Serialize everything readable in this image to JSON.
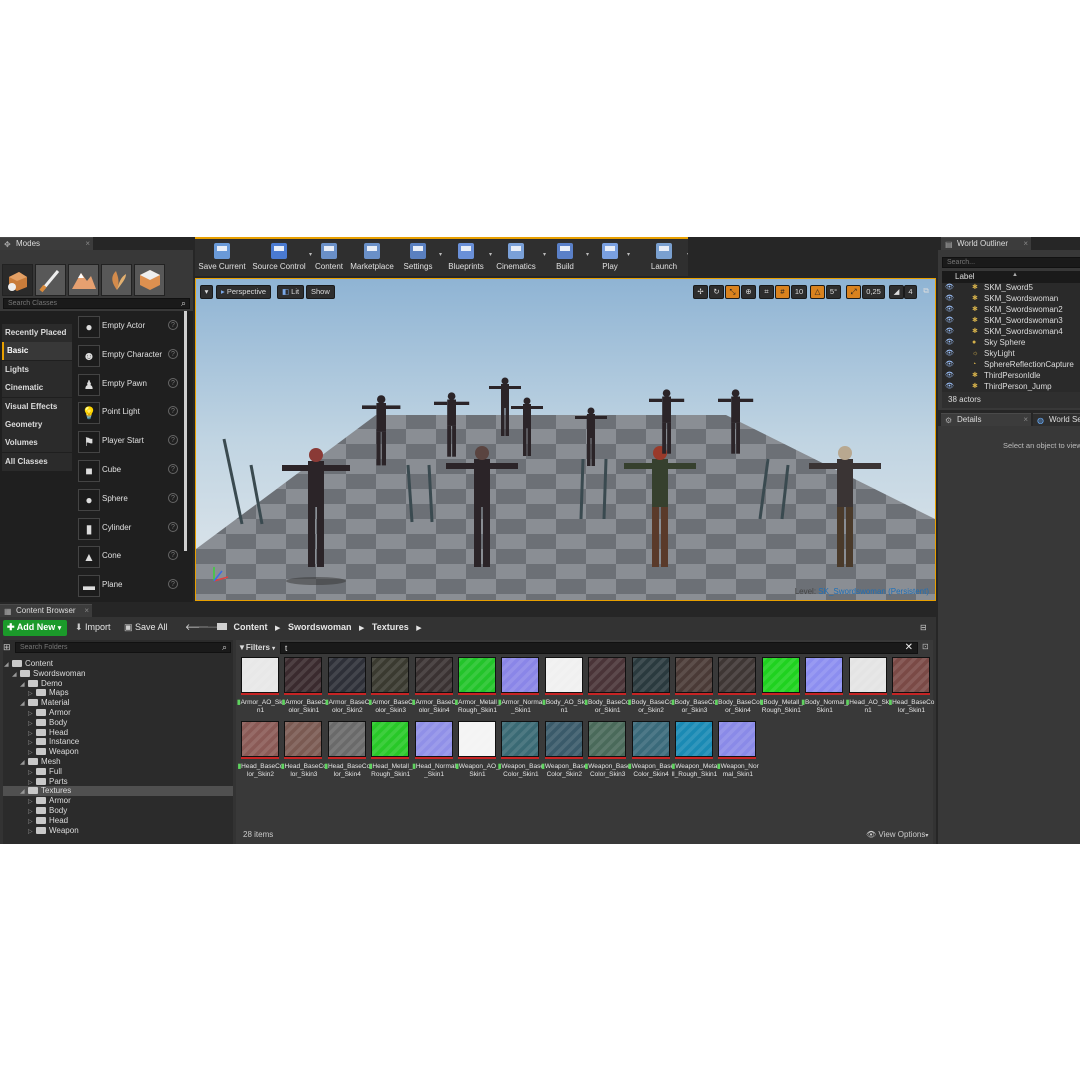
{
  "modes": {
    "tab": "Modes",
    "search_placeholder": "Search Classes",
    "categories": [
      "Recently Placed",
      "Basic",
      "Lights",
      "Cinematic",
      "Visual Effects",
      "Geometry",
      "Volumes",
      "All Classes"
    ],
    "items": [
      "Empty Actor",
      "Empty Character",
      "Empty Pawn",
      "Point Light",
      "Player Start",
      "Cube",
      "Sphere",
      "Cylinder",
      "Cone",
      "Plane"
    ]
  },
  "toolbar": {
    "buttons": [
      "Save Current",
      "Source Control",
      "Content",
      "Marketplace",
      "Settings",
      "Blueprints",
      "Cinematics",
      "Build",
      "Play",
      "Launch"
    ]
  },
  "viewport": {
    "perspective": "Perspective",
    "lit": "Lit",
    "show": "Show",
    "grid_value": "10",
    "angle_value": "5°",
    "scale_value": "0,25",
    "camera_value": "4",
    "level_label": "Level:",
    "level_name": "SK_Swordswoman (Persistent)"
  },
  "outliner": {
    "tab": "World Outliner",
    "search_placeholder": "Search...",
    "column": "Label",
    "rows": [
      "SKM_Sword5",
      "SKM_Swordswoman",
      "SKM_Swordswoman2",
      "SKM_Swordswoman3",
      "SKM_Swordswoman4",
      "Sky Sphere",
      "SkyLight",
      "SphereReflectionCapture",
      "ThirdPersonIdle",
      "ThirdPerson_Jump"
    ],
    "count": "38 actors"
  },
  "details": {
    "tab": "Details",
    "tab2": "World Set",
    "empty_message": "Select an object to view"
  },
  "content_browser": {
    "tab": "Content Browser",
    "add_new": "Add New",
    "import": "Import",
    "save_all": "Save All",
    "path": [
      "Content",
      "Swordswoman",
      "Textures"
    ],
    "folder_search": "Search Folders",
    "filters": "Filters",
    "filter_text": "t",
    "item_count": "28 items",
    "view_options": "View Options",
    "tree": [
      {
        "label": "Content",
        "depth": 0
      },
      {
        "label": "Swordswoman",
        "depth": 1
      },
      {
        "label": "Demo",
        "depth": 2
      },
      {
        "label": "Maps",
        "depth": 3
      },
      {
        "label": "Material",
        "depth": 2
      },
      {
        "label": "Armor",
        "depth": 3
      },
      {
        "label": "Body",
        "depth": 3
      },
      {
        "label": "Head",
        "depth": 3
      },
      {
        "label": "Instance",
        "depth": 3
      },
      {
        "label": "Weapon",
        "depth": 3
      },
      {
        "label": "Mesh",
        "depth": 2
      },
      {
        "label": "Full",
        "depth": 3
      },
      {
        "label": "Parts",
        "depth": 3
      },
      {
        "label": "Textures",
        "depth": 2
      },
      {
        "label": "Armor",
        "depth": 3
      },
      {
        "label": "Body",
        "depth": 3
      },
      {
        "label": "Head",
        "depth": 3
      },
      {
        "label": "Weapon",
        "depth": 3
      }
    ],
    "assets": [
      {
        "name": "Armor_AO_Skin1",
        "color": "#e8e8e8"
      },
      {
        "name": "Armor_BaseColor_Skin1",
        "color": "#3a2a2e"
      },
      {
        "name": "Armor_BaseColor_Skin2",
        "color": "#2e3038"
      },
      {
        "name": "Armor_BaseColor_Skin3",
        "color": "#3a3a30"
      },
      {
        "name": "Armor_BaseColor_Skin4",
        "color": "#3a3232"
      },
      {
        "name": "Armor_Metall_Rough_Skin1",
        "color": "#22c42a"
      },
      {
        "name": "Armor_Normal_Skin1",
        "color": "#8a86e8"
      },
      {
        "name": "Body_AO_Skin1",
        "color": "#f0f0f0"
      },
      {
        "name": "Body_BaseColor_Skin1",
        "color": "#4a3438"
      },
      {
        "name": "Body_BaseColor_Skin2",
        "color": "#2a3a3e"
      },
      {
        "name": "Body_BaseColor_Skin3",
        "color": "#4a3a36"
      },
      {
        "name": "Body_BaseColor_Skin4",
        "color": "#3e3634"
      },
      {
        "name": "Body_Metall_Rough_Skin1",
        "color": "#1fd21f"
      },
      {
        "name": "Body_Normal_Skin1",
        "color": "#8c8ef0"
      },
      {
        "name": "Head_AO_Skin1",
        "color": "#e4e4e4"
      },
      {
        "name": "Head_BaseColor_Skin1",
        "color": "#7a4a46"
      },
      {
        "name": "Head_BaseColor_Skin2",
        "color": "#8a5a56"
      },
      {
        "name": "Head_BaseColor_Skin3",
        "color": "#7a5a52"
      },
      {
        "name": "Head_BaseColor_Skin4",
        "color": "#6a6a6a"
      },
      {
        "name": "Head_Metall_Rough_Skin1",
        "color": "#28c828"
      },
      {
        "name": "Head_Normal_Skin1",
        "color": "#9090e8"
      },
      {
        "name": "Weapon_AO_Skin1",
        "color": "#f4f4f4"
      },
      {
        "name": "Weapon_BaseColor_Skin1",
        "color": "#3a6a74"
      },
      {
        "name": "Weapon_BaseColor_Skin2",
        "color": "#3a5a6a"
      },
      {
        "name": "Weapon_BaseColor_Skin3",
        "color": "#4a6a5a"
      },
      {
        "name": "Weapon_BaseColor_Skin4",
        "color": "#3a6a7a"
      },
      {
        "name": "Weapon_Metall_Rough_Skin1",
        "color": "#1a8ab4"
      },
      {
        "name": "Weapon_Normal_Skin1",
        "color": "#8a8ae8"
      }
    ]
  },
  "colors": {
    "accent": "#e8a000",
    "add_new": "#1b9a2a",
    "selection": "#335a8a"
  }
}
